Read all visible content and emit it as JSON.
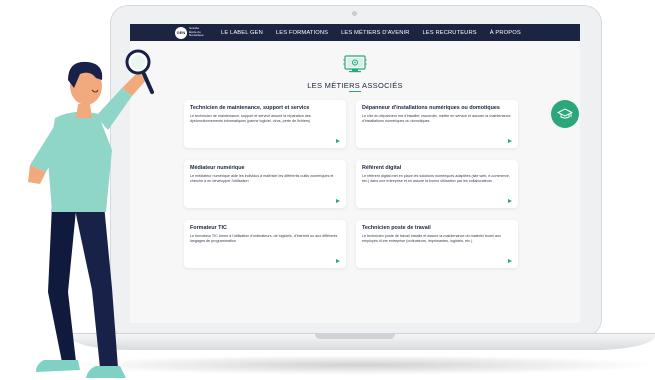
{
  "nav": {
    "logo_initials": "GEN",
    "logo_text": "Grande École du Numérique",
    "items": [
      {
        "label": "LE LABEL GEN"
      },
      {
        "label": "LES FORMATIONS"
      },
      {
        "label": "LES MÉTIERS D'AVENIR"
      },
      {
        "label": "LES RECRUTEURS"
      },
      {
        "label": "À PROPOS"
      }
    ]
  },
  "section": {
    "title": "LES MÉTIERS ASSOCIÉS",
    "icon": "computer-gear-icon"
  },
  "cards": [
    {
      "title": "Technicien de maintenance, support et service",
      "desc": "Le technicien de maintenance, support et service assure la réparation des dysfonctionnements informatiques (panne logiciel, virus, perte de fichiers)"
    },
    {
      "title": "Dépanneur d'installations numériques ou domotiques",
      "desc": "Le rôle du dépanneur est d'installer, raccorder, mettre en service et assurer la maintenance d'installations numériques ou domotiques"
    },
    {
      "title": "Médiateur numérique",
      "desc": "Le médiateur numérique aide les individus à maîtriser les différents outils numériques et cherche à en développer l'utilisation"
    },
    {
      "title": "Référent digital",
      "desc": "Le référent digital met en place les solutions numériques adaptées (site web, e-commerce, etc.) dans une entreprise et en assure la bonne utilisation par les collaborateurs"
    },
    {
      "title": "Formateur TIC",
      "desc": "Le formateur TIC forme à l'utilisation d'ordinateurs, de logiciels, d'Internet ou aux différents langages de programmation"
    },
    {
      "title": "Technicien poste de travail",
      "desc": "Le technicien poste de travail installe et assure la maintenance du matériel fourni aux employés d'une entreprise (ordinateurs, imprimantes, logiciels, etc.)"
    }
  ],
  "side_badge": {
    "icon": "graduation-cap-icon"
  },
  "colors": {
    "nav_bg": "#1b2441",
    "accent": "#2aa77b",
    "page_bg": "#f7f7f7"
  }
}
